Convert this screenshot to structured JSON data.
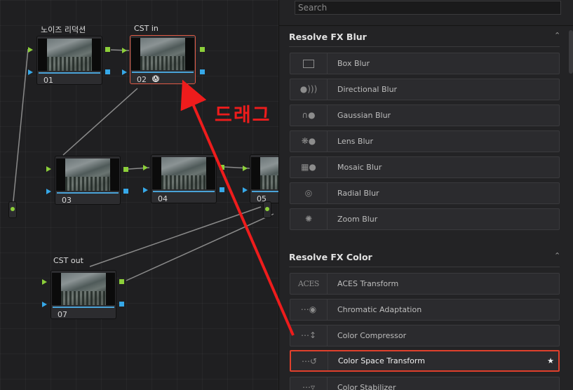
{
  "nodes": [
    {
      "id": "01",
      "label": "노이즈 리덕션",
      "number": "01"
    },
    {
      "id": "02",
      "label": "CST in",
      "number": "02",
      "badge": "Ⓐ"
    },
    {
      "id": "03",
      "label": "",
      "number": "03"
    },
    {
      "id": "04",
      "label": "",
      "number": "04"
    },
    {
      "id": "05",
      "label": "",
      "number": "05"
    },
    {
      "id": "07",
      "label": "CST out",
      "number": "07"
    }
  ],
  "fx_panel": {
    "search_placeholder": "Search",
    "categories": [
      {
        "title": "Resolve FX Blur",
        "items": [
          {
            "label": "Box Blur",
            "icon": "box-blur-icon"
          },
          {
            "label": "Directional Blur",
            "icon": "directional-blur-icon"
          },
          {
            "label": "Gaussian Blur",
            "icon": "gaussian-blur-icon"
          },
          {
            "label": "Lens Blur",
            "icon": "lens-blur-icon"
          },
          {
            "label": "Mosaic Blur",
            "icon": "mosaic-blur-icon"
          },
          {
            "label": "Radial Blur",
            "icon": "radial-blur-icon"
          },
          {
            "label": "Zoom Blur",
            "icon": "zoom-blur-icon"
          }
        ]
      },
      {
        "title": "Resolve FX Color",
        "items": [
          {
            "label": "ACES Transform",
            "icon": "aces-icon",
            "icon_text": "ACES"
          },
          {
            "label": "Chromatic Adaptation",
            "icon": "chromatic-adaptation-icon"
          },
          {
            "label": "Color Compressor",
            "icon": "color-compressor-icon"
          },
          {
            "label": "Color Space Transform",
            "icon": "color-space-transform-icon",
            "highlighted": true,
            "favorite": "★"
          },
          {
            "label": "Color Stabilizer",
            "icon": "color-stabilizer-icon"
          }
        ]
      }
    ]
  },
  "annotation": {
    "text": "드래그",
    "color": "#ee1c1c"
  },
  "colors": {
    "accent_red": "#e0402c",
    "port_green": "#8ccf3a",
    "port_blue": "#36a8e8",
    "panel_bg": "#232325"
  }
}
